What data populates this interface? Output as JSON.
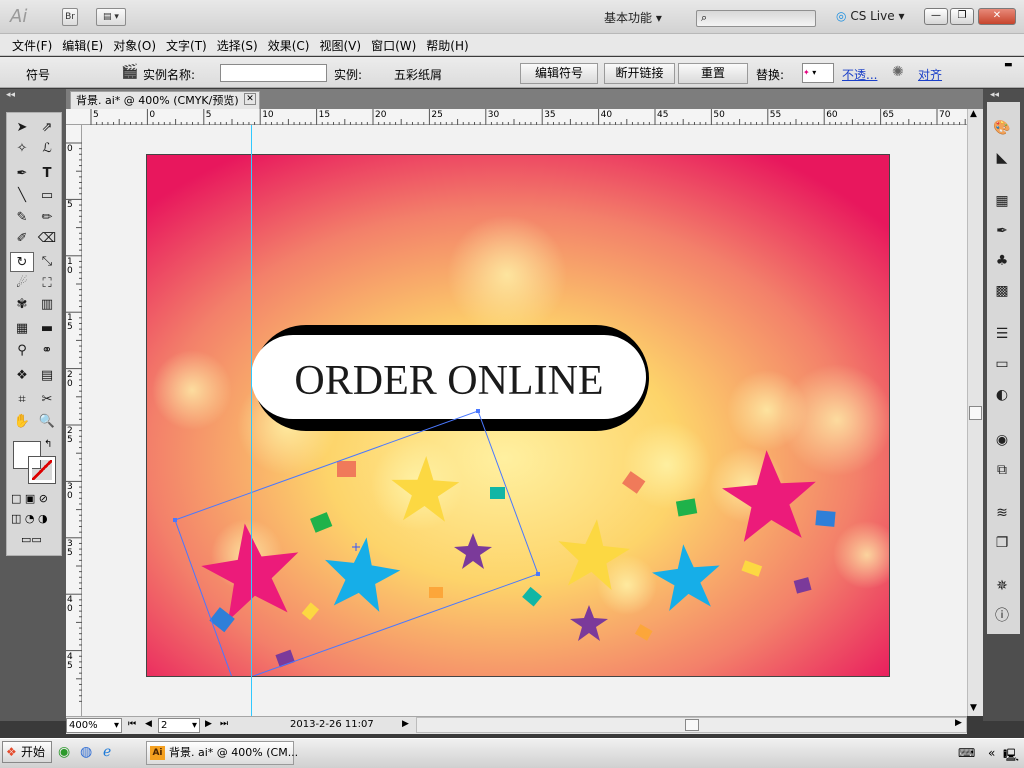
{
  "app": {
    "logo": "Ai",
    "bridge": "Br",
    "workspace": "基本功能",
    "cs_live": "CS Live",
    "window_controls": [
      "minimize-icon",
      "restore-icon",
      "close-icon"
    ]
  },
  "menu": [
    "文件(F)",
    "编辑(E)",
    "对象(O)",
    "文字(T)",
    "选择(S)",
    "效果(C)",
    "视图(V)",
    "窗口(W)",
    "帮助(H)"
  ],
  "control_bar": {
    "symbol_label": "符号",
    "instance_name_label": "实例名称:",
    "instance_name_value": "",
    "instance_label": "实例:",
    "instance_value": "五彩纸屑",
    "edit_symbol": "编辑符号",
    "break_link": "断开链接",
    "reset": "重置",
    "replace_label": "替换:",
    "opacity_link": "不透...",
    "align_link": "对齐"
  },
  "document": {
    "tab_title": "背景. ai* @ 400% (CMYK/预览)",
    "ruler_h": [
      "5",
      "0",
      "5",
      "10",
      "15",
      "20",
      "25",
      "30",
      "35",
      "40",
      "45",
      "50",
      "55",
      "60",
      "65",
      "70"
    ],
    "ruler_v": [
      "0",
      "5",
      "1 0",
      "1 5",
      "2 0",
      "2 5",
      "3 0",
      "3 5",
      "4 0",
      "4 5"
    ]
  },
  "artwork": {
    "headline": "ORDER ONLINE",
    "colors": {
      "magenta": "#ec1b7a",
      "cyan": "#16aee8",
      "yellow": "#fcd842",
      "purple": "#7b3a9a",
      "background_edge": "#e8175d",
      "background_center": "#fde27a",
      "selection": "#4a78ff"
    }
  },
  "status": {
    "zoom": "400%",
    "artboard": "2",
    "date": "2013-2-26  11:07"
  },
  "taskbar": {
    "start": "开始",
    "task": "背景. ai* @ 400% (CM..."
  }
}
